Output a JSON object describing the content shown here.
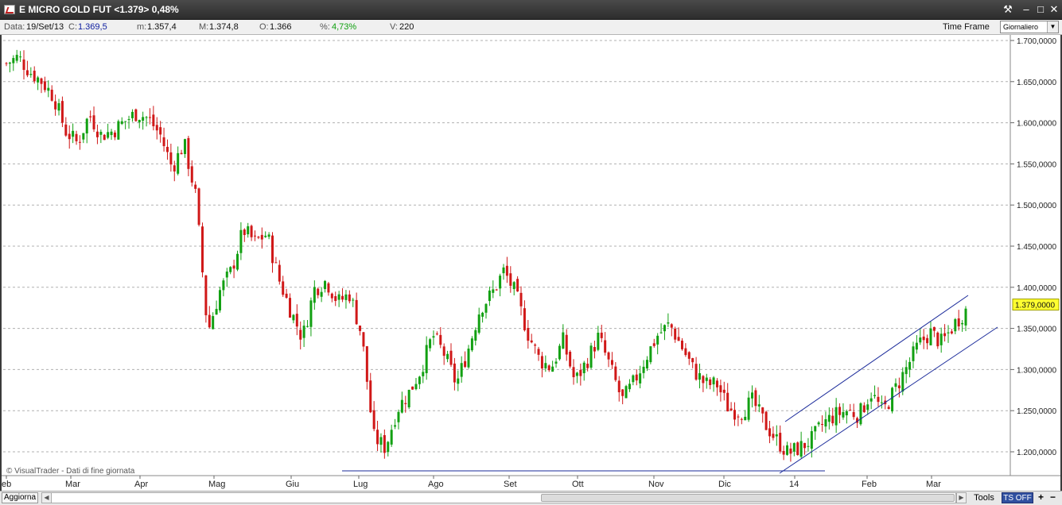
{
  "window": {
    "title": "E MICRO GOLD FUT <1.379> 0,48%",
    "buttons": [
      "tools-icon",
      "minimize-icon",
      "maximize-icon",
      "close-icon"
    ]
  },
  "infobar": {
    "data_label": "Data:",
    "data_value": "19/Set/13",
    "c_label": "C:",
    "c_value": "1.369,5",
    "m_label": "m:",
    "m_value": "1.357,4",
    "M_label": "M:",
    "M_value": "1.374,8",
    "o_label": "O:",
    "o_value": "1.366",
    "pct_label": "%:",
    "pct_value": "4,73%",
    "v_label": "V:",
    "v_value": "220",
    "timeframe_label": "Time Frame",
    "timeframe_value": "Giornaliero"
  },
  "chart_data": {
    "type": "candlestick",
    "y_tick_labels": [
      "1.700,0000",
      "1.650,0000",
      "1.600,0000",
      "1.550,0000",
      "1.500,0000",
      "1.450,0000",
      "1.400,0000",
      "1.350,0000",
      "1.300,0000",
      "1.250,0000",
      "1.200,0000"
    ],
    "y_ticks": [
      1700,
      1650,
      1600,
      1550,
      1500,
      1450,
      1400,
      1350,
      1300,
      1250,
      1200
    ],
    "ylim": [
      1175,
      1720
    ],
    "x_tick_labels": [
      "eb",
      "Mar",
      "Apr",
      "Mag",
      "Giu",
      "Lug",
      "Ago",
      "Set",
      "Ott",
      "Nov",
      "Dic",
      "14",
      "Feb",
      "Mar"
    ],
    "last_price_label": "1.379,0000",
    "last_price": 1379,
    "watermark": "© VisualTrader - Dati di fine giornata",
    "grid": "dashed horizontal",
    "colors": {
      "up": "#12a012",
      "down": "#d01818",
      "trendline": "#1a2a9a"
    },
    "closes": [
      1672,
      1680,
      1662,
      1650,
      1632,
      1590,
      1575,
      1610,
      1585,
      1590,
      1602,
      1612,
      1605,
      1585,
      1545,
      1575,
      1510,
      1345,
      1395,
      1420,
      1470,
      1455,
      1465,
      1410,
      1372,
      1338,
      1398,
      1408,
      1382,
      1392,
      1342,
      1218,
      1205,
      1252,
      1272,
      1300,
      1342,
      1318,
      1282,
      1325,
      1375,
      1392,
      1420,
      1392,
      1345,
      1312,
      1302,
      1335,
      1285,
      1310,
      1340,
      1302,
      1262,
      1285,
      1315,
      1342,
      1355,
      1328,
      1300,
      1282,
      1282,
      1252,
      1248,
      1262,
      1235,
      1215,
      1198,
      1205,
      1215,
      1235,
      1245,
      1250,
      1245,
      1272,
      1248,
      1275,
      1302,
      1330,
      1345,
      1332,
      1355,
      1372
    ]
  },
  "bottombar": {
    "refresh_label": "Aggiorna",
    "tools_label": "Tools",
    "ts_label": "TS OFF",
    "plus_label": "+",
    "minus_label": "−"
  }
}
